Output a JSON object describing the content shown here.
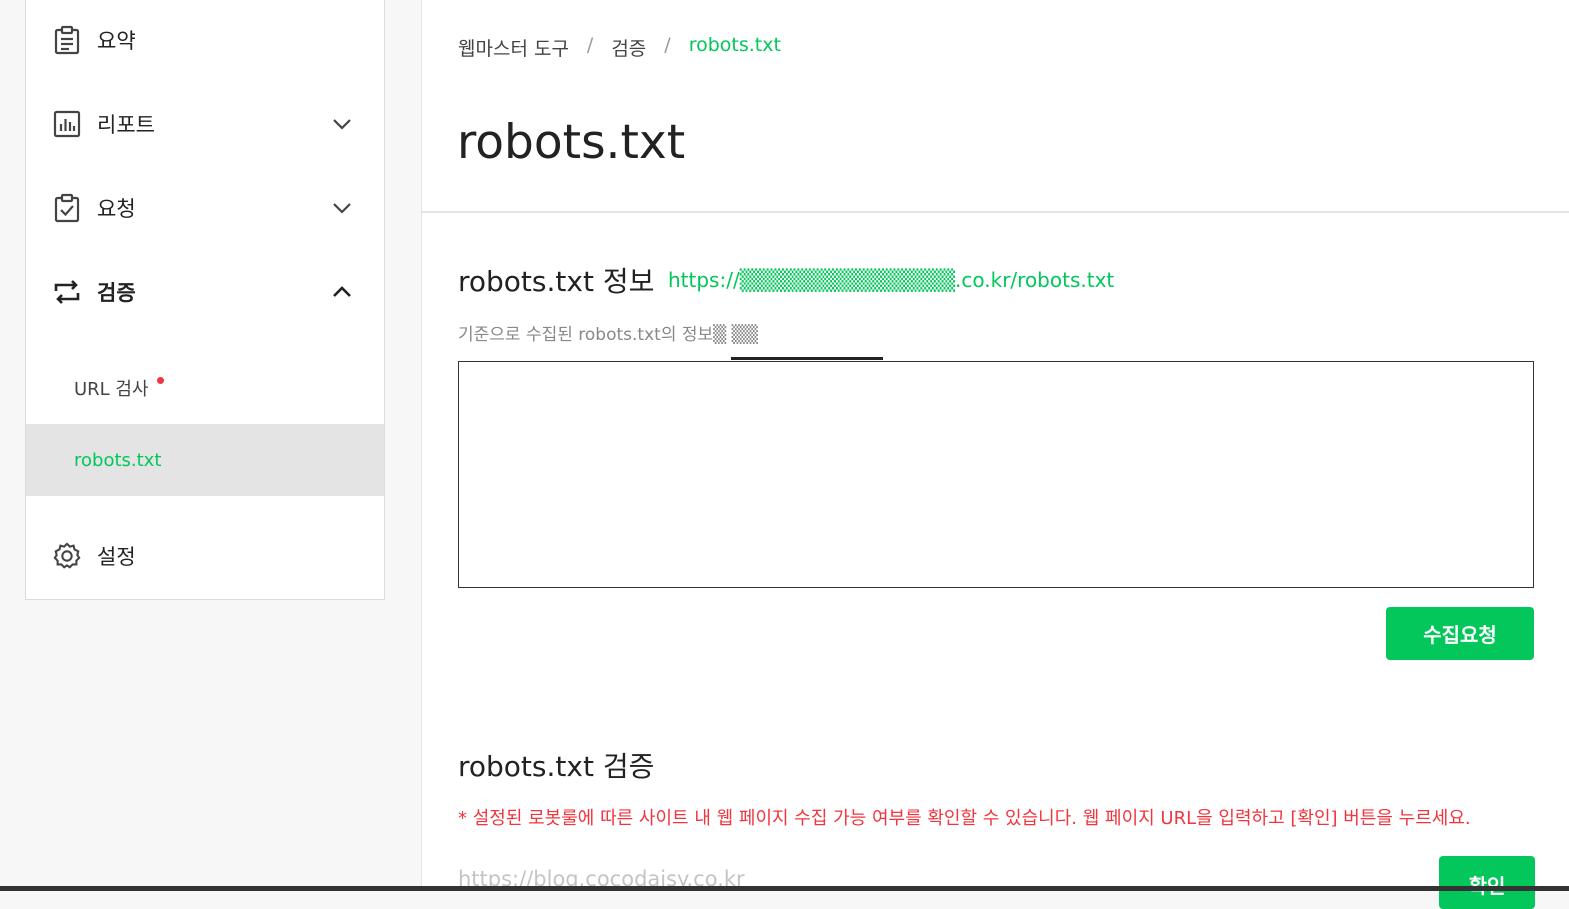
{
  "sidebar": {
    "items": [
      {
        "label": "요약",
        "icon": "clipboard-icon"
      },
      {
        "label": "리포트",
        "icon": "chart-icon"
      },
      {
        "label": "요청",
        "icon": "clipboard-check-icon"
      },
      {
        "label": "검증",
        "icon": "repeat-icon"
      },
      {
        "label": "설정",
        "icon": "gear-icon"
      }
    ],
    "sub_items": [
      {
        "label": "URL 검사",
        "has_new": true
      },
      {
        "label": "robots.txt",
        "active": true
      }
    ]
  },
  "breadcrumb": [
    "웹마스터 도구",
    "검증",
    "robots.txt"
  ],
  "breadcrumb_sep": "/",
  "page_title": "robots.txt",
  "info_section": {
    "title": "robots.txt 정보",
    "url": "https://▒▒▒▒▒▒▒▒▒▒▒▒▒▒.co.kr/robots.txt",
    "desc": "기준으로 수집된 robots.txt의 정보▒ ▒▒",
    "content": "",
    "button": "수집요청"
  },
  "verify_section": {
    "title": "robots.txt 검증",
    "notice": "* 설정된 로봇룰에 따른 사이트 내 웹 페이지 수집 가능 여부를 확인할 수 있습니다. 웹 페이지 URL을 입력하고 [확인] 버튼을 누르세요.",
    "placeholder": "https://blog.cocodaisy.co.kr",
    "button": "확인"
  },
  "colors": {
    "accent": "#03c75a",
    "alert": "#f0353e",
    "active_bg": "#e4e4e4"
  }
}
